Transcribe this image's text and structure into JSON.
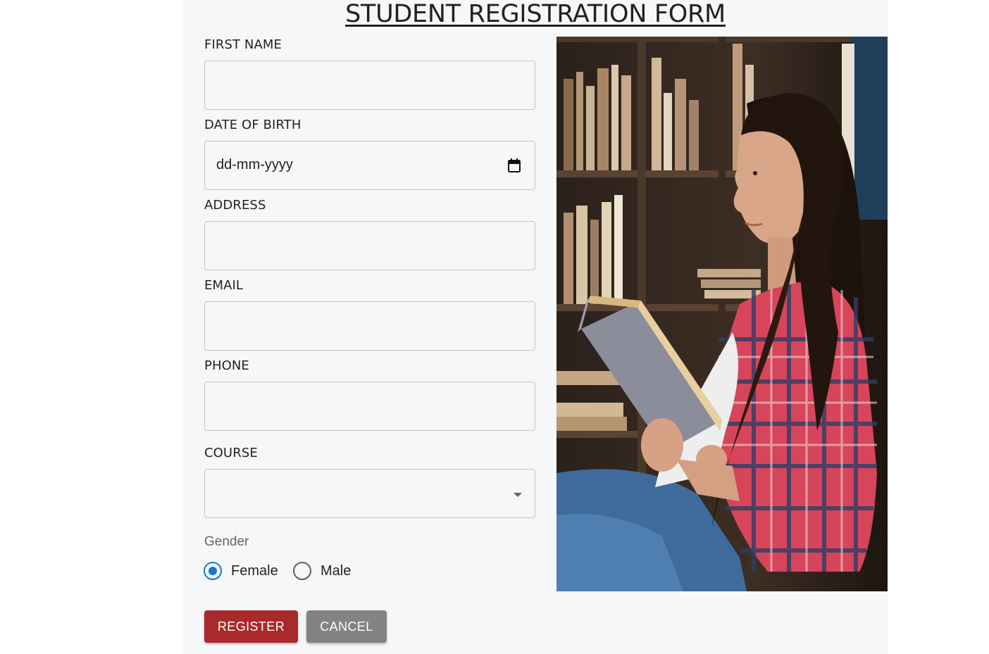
{
  "form": {
    "title": "STUDENT REGISTRATION FORM",
    "fields": {
      "first_name": {
        "label": "FIRST NAME",
        "value": ""
      },
      "date_of_birth": {
        "label": "DATE OF BIRTH",
        "placeholder": "dd-mm-yyyy"
      },
      "address": {
        "label": "ADDRESS",
        "value": ""
      },
      "email": {
        "label": "EMAIL",
        "value": ""
      },
      "phone": {
        "label": "PHONE",
        "value": ""
      },
      "course": {
        "label": "COURSE",
        "selected": ""
      }
    },
    "gender": {
      "label": "Gender",
      "options": [
        {
          "label": "Female",
          "checked": true
        },
        {
          "label": "Male",
          "checked": false
        }
      ]
    },
    "buttons": {
      "register": "REGISTER",
      "cancel": "CANCEL"
    }
  },
  "colors": {
    "panel_background": "#f6f7f9",
    "register_button": "#a82a2b",
    "cancel_button": "#838383",
    "radio_accent": "#1976d2"
  },
  "icons": {
    "date": "calendar-icon",
    "course": "dropdown-arrow-icon"
  }
}
